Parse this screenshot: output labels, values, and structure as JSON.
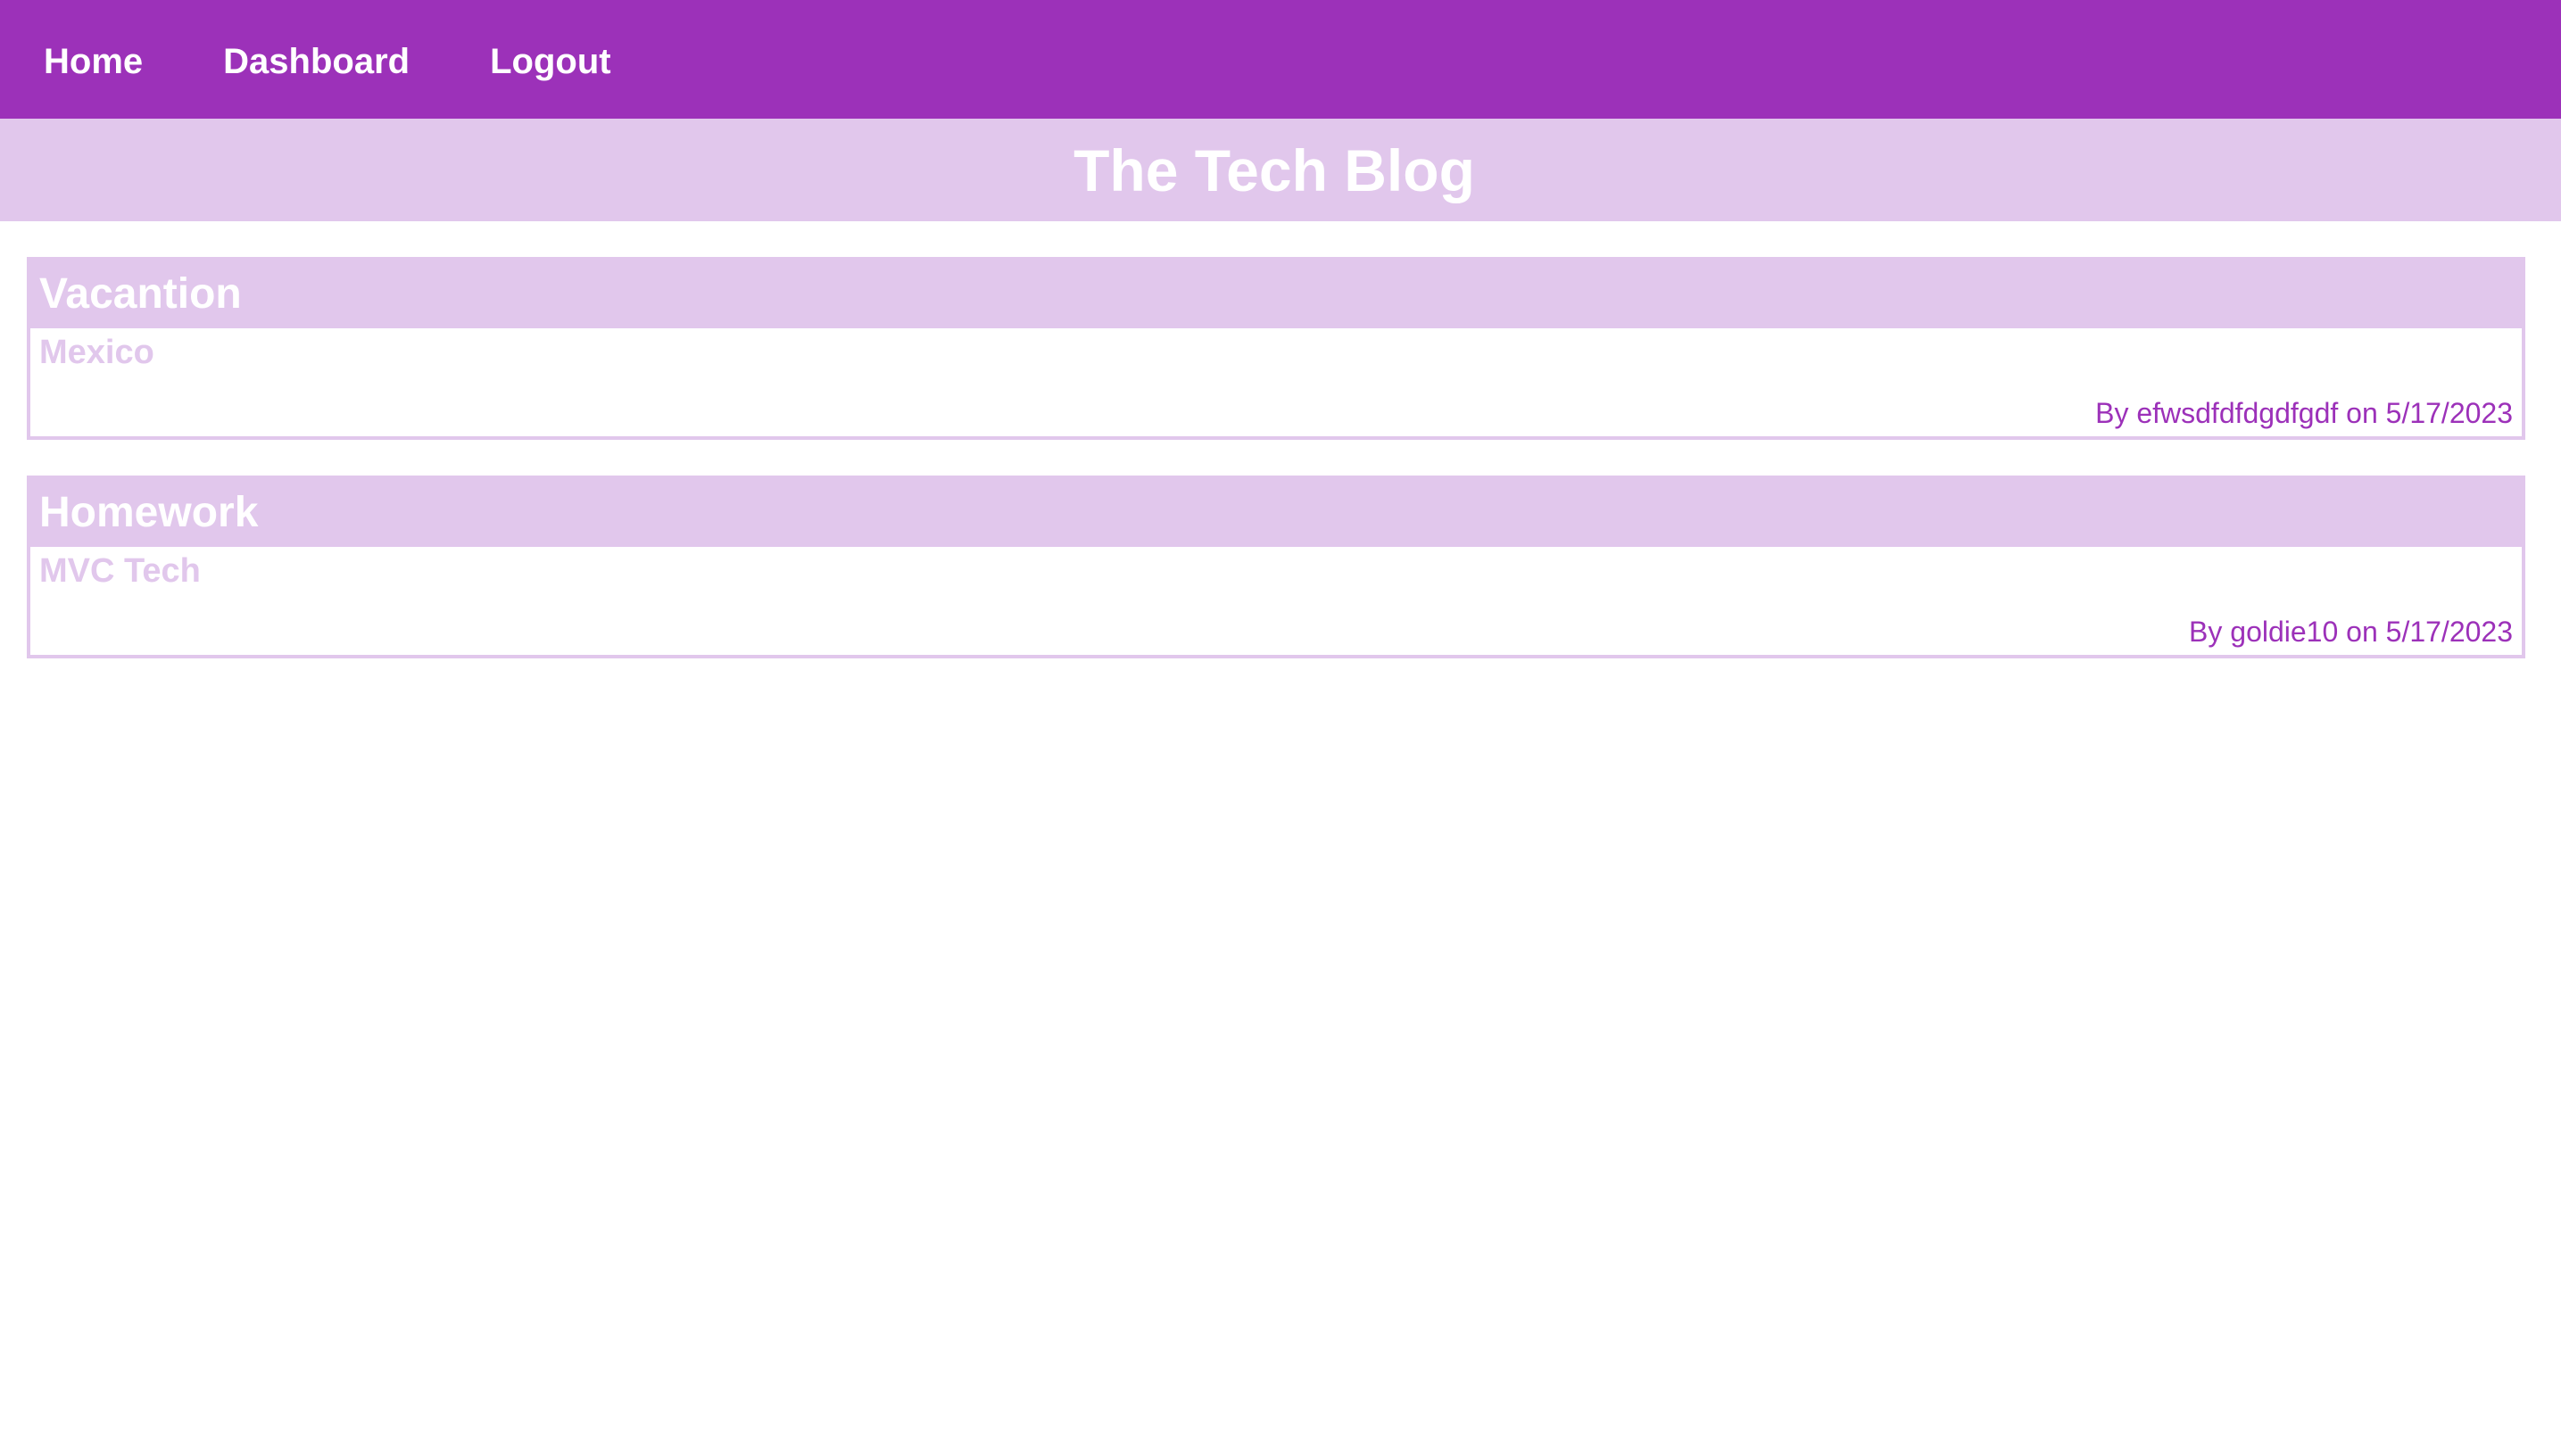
{
  "nav": {
    "items": [
      {
        "label": "Home"
      },
      {
        "label": "Dashboard"
      },
      {
        "label": "Logout"
      }
    ]
  },
  "header": {
    "title": "The Tech Blog"
  },
  "posts": [
    {
      "title": "Vacantion",
      "content": "Mexico",
      "meta": "By efwsdfdfdgdfgdf on 5/17/2023"
    },
    {
      "title": "Homework",
      "content": "MVC Tech",
      "meta": "By goldie10 on 5/17/2023"
    }
  ],
  "colors": {
    "nav_bg": "#9c31b9",
    "accent_light": "#e1c7ec",
    "meta_text": "#9c31b9",
    "page_bg": "#ffffff"
  }
}
